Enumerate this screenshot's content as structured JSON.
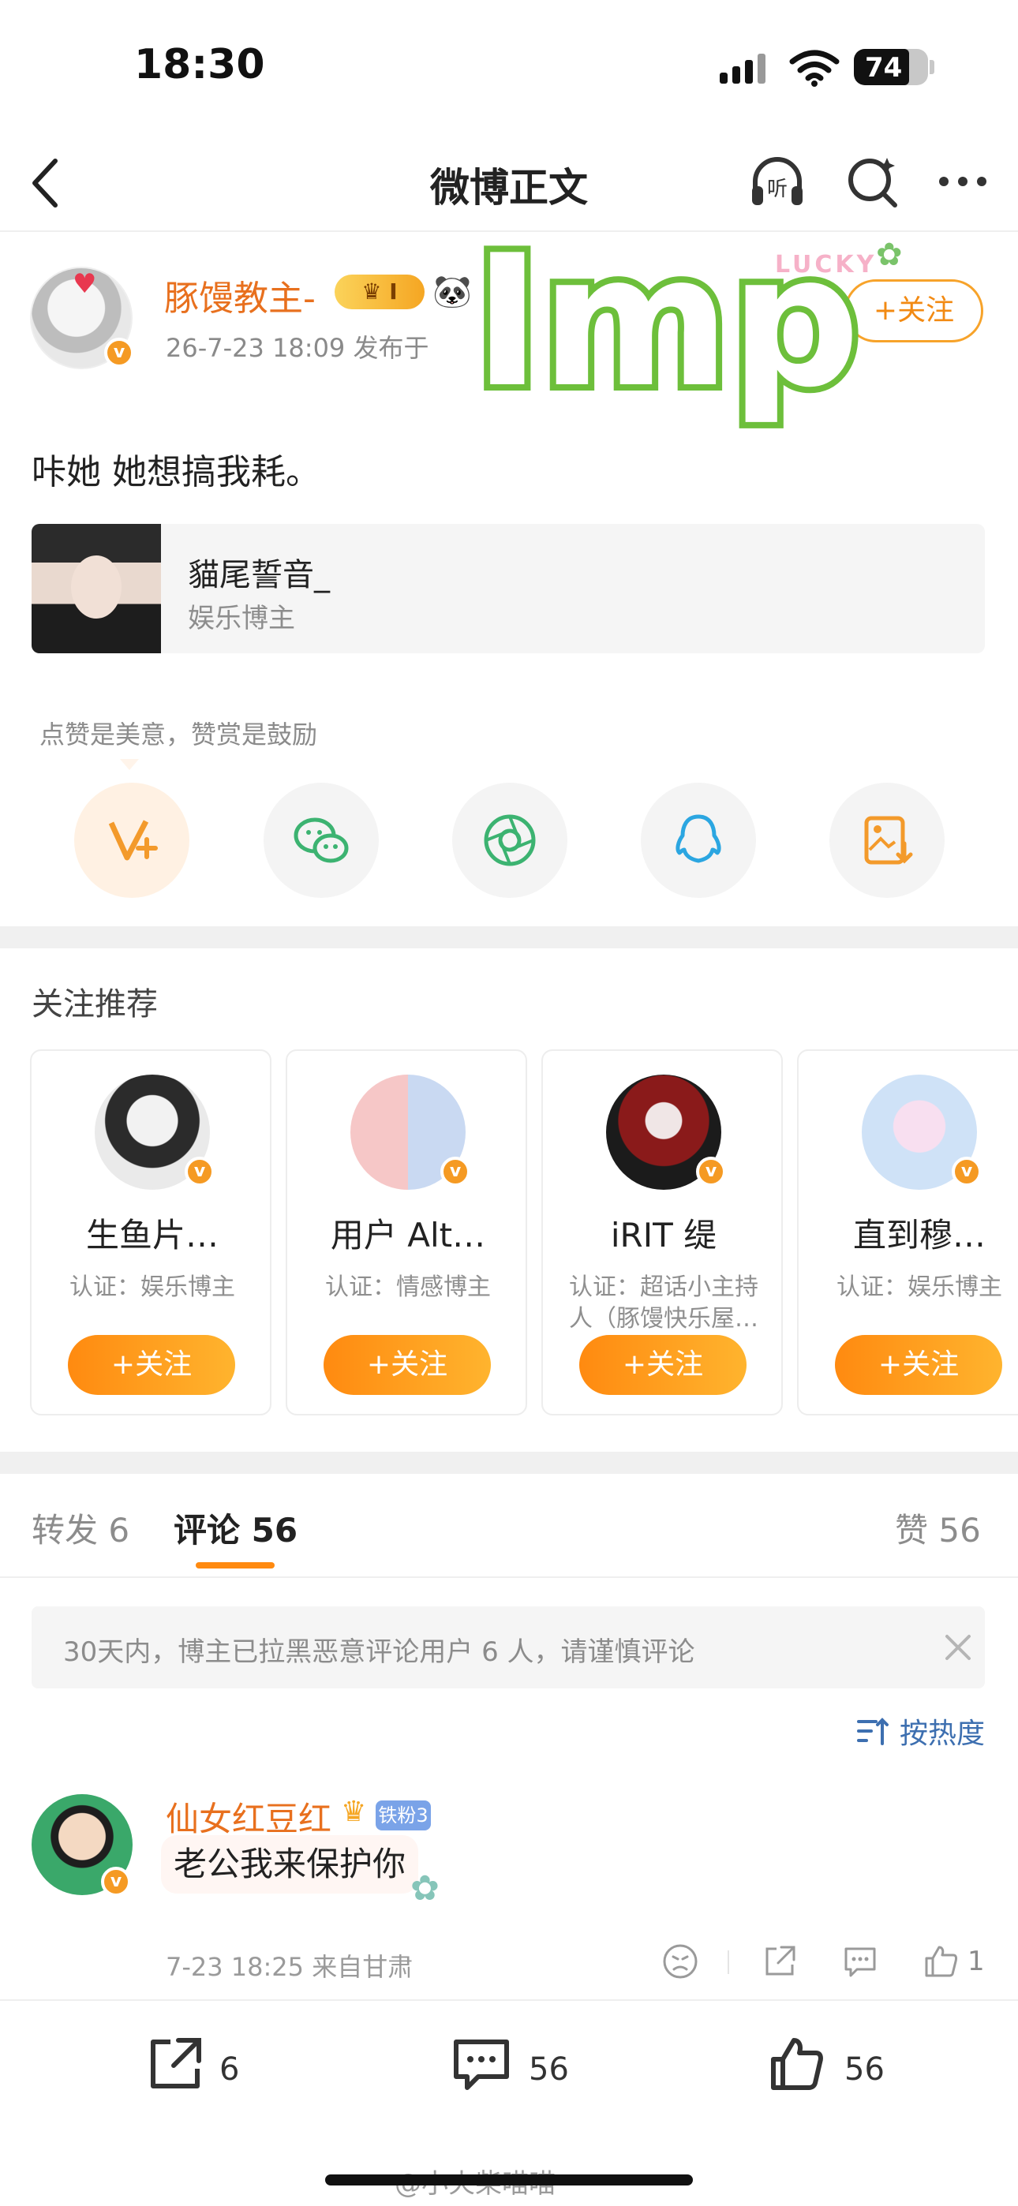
{
  "status_bar": {
    "time": "18:30",
    "battery": "74"
  },
  "nav": {
    "title": "微博正文",
    "listen_label": "听"
  },
  "post": {
    "author": "豚馒教主-",
    "crown_badge": "I",
    "meta": "26-7-23 18:09  发布于",
    "follow_label": "+关注",
    "lucky": "LUCKY",
    "watermark": "Imp",
    "text": "咔她 她想搞我耗。",
    "mention": {
      "name": "貓尾誓音_",
      "desc": "娱乐博主"
    }
  },
  "reward": {
    "tip": "点赞是美意，赞赏是鼓励"
  },
  "recommend": {
    "title": "关注推荐",
    "items": [
      {
        "name": "生鱼片…",
        "cert": "认证：娱乐博主",
        "follow": "+关注"
      },
      {
        "name": "用户 Alt…",
        "cert": "认证：情感博主",
        "follow": "+关注"
      },
      {
        "name": "iRIT 缇",
        "cert": "认证：超话小主持人（豚馒快乐屋…",
        "follow": "+关注"
      },
      {
        "name": "直到穆…",
        "cert": "认证：娱乐博主",
        "follow": "+关注"
      }
    ]
  },
  "tabs": {
    "repost": "转发 6",
    "comment": "评论 56",
    "like": "赞 56"
  },
  "notice": {
    "text": "30天内，博主已拉黑恶意评论用户 6 人，请谨慎评论"
  },
  "sort": {
    "label": "按热度"
  },
  "comment": {
    "name": "仙女红豆红",
    "fan_badge": "铁粉3",
    "text": "老公我来保护你",
    "meta": "7-23 18:25  来自甘肃",
    "like_count": "1"
  },
  "bottom": {
    "repost_count": "6",
    "comment_count": "56",
    "like_count": "56"
  },
  "credit": "@小火柴喵喵",
  "colors": {
    "accent": "#ff8a10",
    "author": "#e8701e",
    "link": "#3d6fb0",
    "watermark": "#6dbf3b"
  }
}
